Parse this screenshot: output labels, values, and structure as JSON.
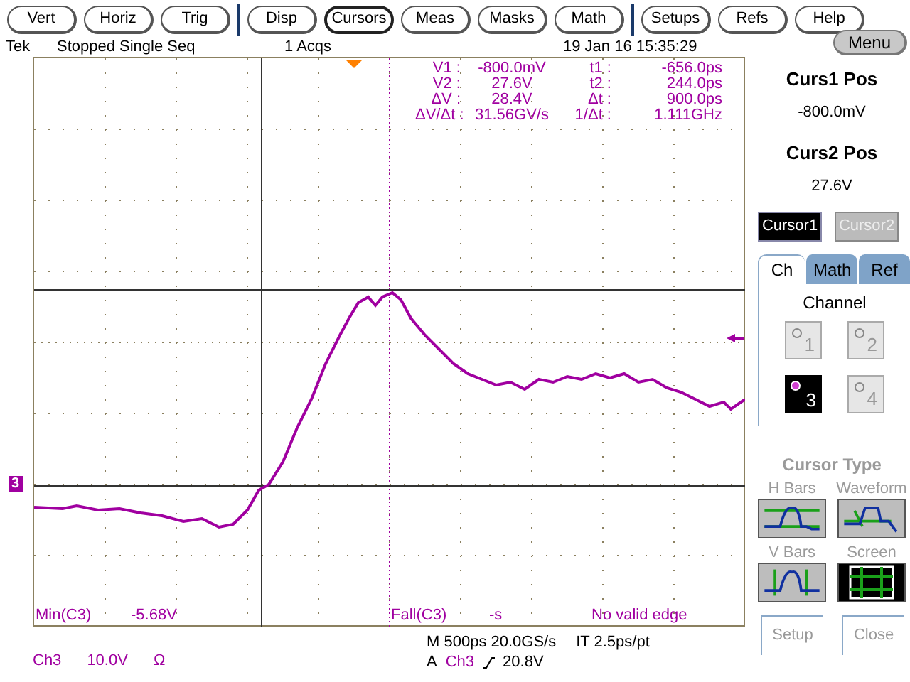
{
  "menu_bar": [
    {
      "label": "Vert",
      "selected": false
    },
    {
      "label": "Horiz",
      "selected": false
    },
    {
      "label": "Trig",
      "selected": false
    },
    {
      "label": "Disp",
      "selected": false
    },
    {
      "label": "Cursors",
      "selected": true
    },
    {
      "label": "Meas",
      "selected": false
    },
    {
      "label": "Masks",
      "selected": false
    },
    {
      "label": "Math",
      "selected": false
    },
    {
      "label": "Setups",
      "selected": false
    },
    {
      "label": "Refs",
      "selected": false
    },
    {
      "label": "Help",
      "selected": false
    }
  ],
  "status": {
    "brand": "Tek",
    "state": "Stopped",
    "mode": "Single Seq",
    "acqs": "1 Acqs",
    "datetime": "19 Jan 16 15:35:29"
  },
  "cursor_readout": [
    {
      "left_label": "V1 :",
      "left_value": "-800.0mV",
      "right_label": "t1 :",
      "right_value": "-656.0ps"
    },
    {
      "left_label": "V2 :",
      "left_value": "27.6V",
      "right_label": "t2 :",
      "right_value": "244.0ps"
    },
    {
      "left_label": "ΔV :",
      "left_value": "28.4V",
      "right_label": "Δt :",
      "right_value": "900.0ps"
    },
    {
      "left_label": "ΔV/Δt :",
      "left_value": "31.56GV/s",
      "right_label": "1/Δt :",
      "right_value": "1.111GHz"
    }
  ],
  "measurements": [
    {
      "label": "Min(C3)",
      "value": "-5.68V"
    },
    {
      "label": "Fall(C3)",
      "value": "-s",
      "note": "No valid edge"
    }
  ],
  "ground_marker": "3",
  "channel_info": {
    "channel": "Ch3",
    "scale": "10.0V",
    "coupling": "Ω"
  },
  "timebase": {
    "horizontal": "M 500ps 20.0GS/s",
    "interpolation": "IT 2.5ps/pt",
    "trigger_source": "A",
    "trigger_channel": "Ch3",
    "trigger_level": "20.8V"
  },
  "side_panel": {
    "menu_button": "Menu",
    "curs1_label": "Curs1 Pos",
    "curs1_value": "-800.0mV",
    "curs2_label": "Curs2 Pos",
    "curs2_value": "27.6V",
    "cursor_buttons": [
      {
        "label": "Cursor1",
        "selected": true
      },
      {
        "label": "Cursor2",
        "selected": false
      }
    ],
    "tabs": [
      {
        "label": "Ch",
        "selected": true
      },
      {
        "label": "Math",
        "selected": false
      },
      {
        "label": "Ref",
        "selected": false
      }
    ],
    "channel_heading": "Channel",
    "channels": [
      {
        "label": "1",
        "selected": false
      },
      {
        "label": "2",
        "selected": false
      },
      {
        "label": "3",
        "selected": true
      },
      {
        "label": "4",
        "selected": false
      }
    ],
    "cursor_type": {
      "title": "Cursor Type",
      "disabled": true,
      "options": [
        {
          "label": "H Bars",
          "kind": "hbars",
          "selected": false
        },
        {
          "label": "Waveform",
          "kind": "waveform",
          "selected": false
        },
        {
          "label": "V Bars",
          "kind": "vbars",
          "selected": false
        },
        {
          "label": "Screen",
          "kind": "screen",
          "selected": true
        }
      ]
    },
    "footer_buttons": [
      {
        "label": "Setup",
        "disabled": true
      },
      {
        "label": "Close",
        "disabled": true
      }
    ]
  }
}
